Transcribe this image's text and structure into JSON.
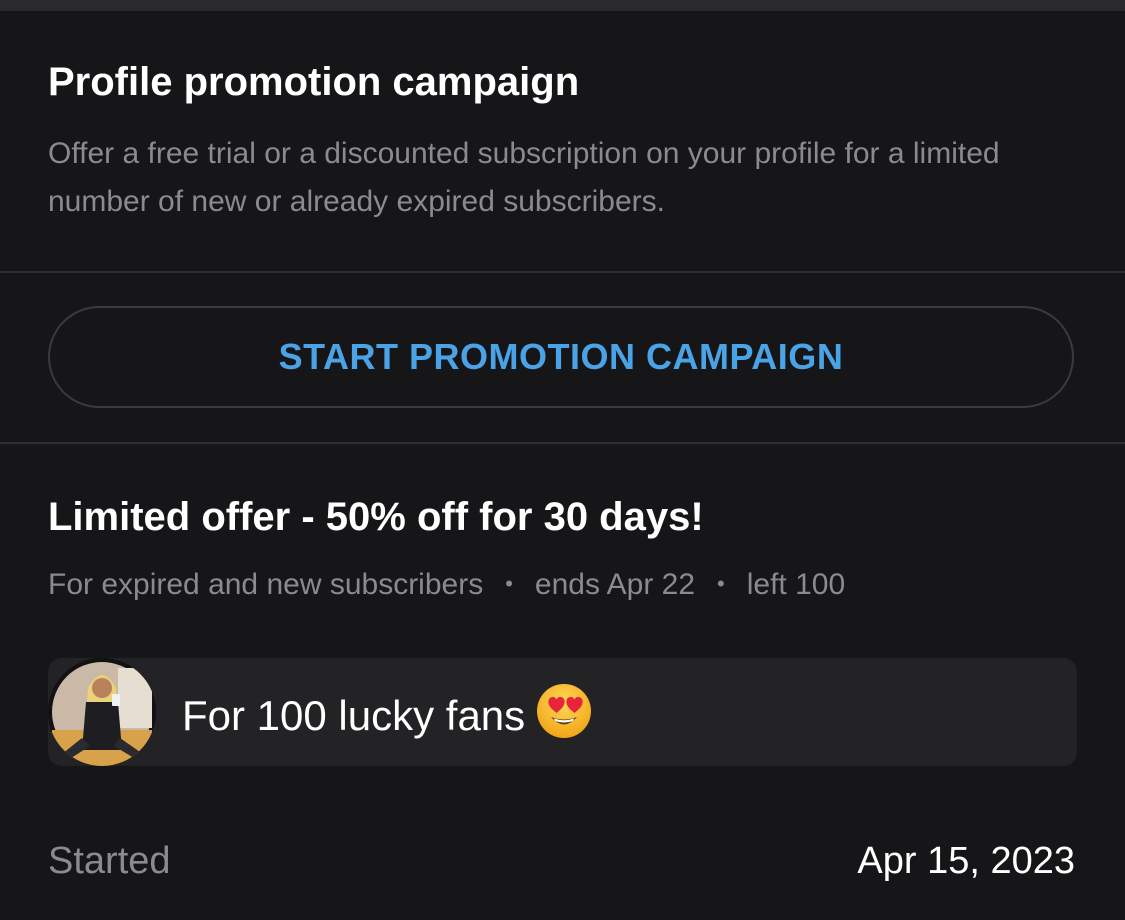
{
  "promotion": {
    "title": "Profile promotion campaign",
    "description": "Offer a free trial or a discounted subscription on your profile for a limited number of new or already expired subscribers.",
    "start_button_label": "START PROMOTION CAMPAIGN"
  },
  "offer": {
    "title": "Limited offer - 50% off for 30 days!",
    "audience": "For expired and new subscribers",
    "ends": "ends Apr 22",
    "left": "left 100",
    "message": "For 100 lucky fans",
    "emoji": "smiling-face-with-heart-eyes-icon"
  },
  "details": {
    "started_label": "Started",
    "started_value": "Apr 15, 2023"
  },
  "colors": {
    "background": "#161618",
    "accent": "#4aa3e6",
    "muted_text": "#8a8a90",
    "card": "#232326"
  }
}
